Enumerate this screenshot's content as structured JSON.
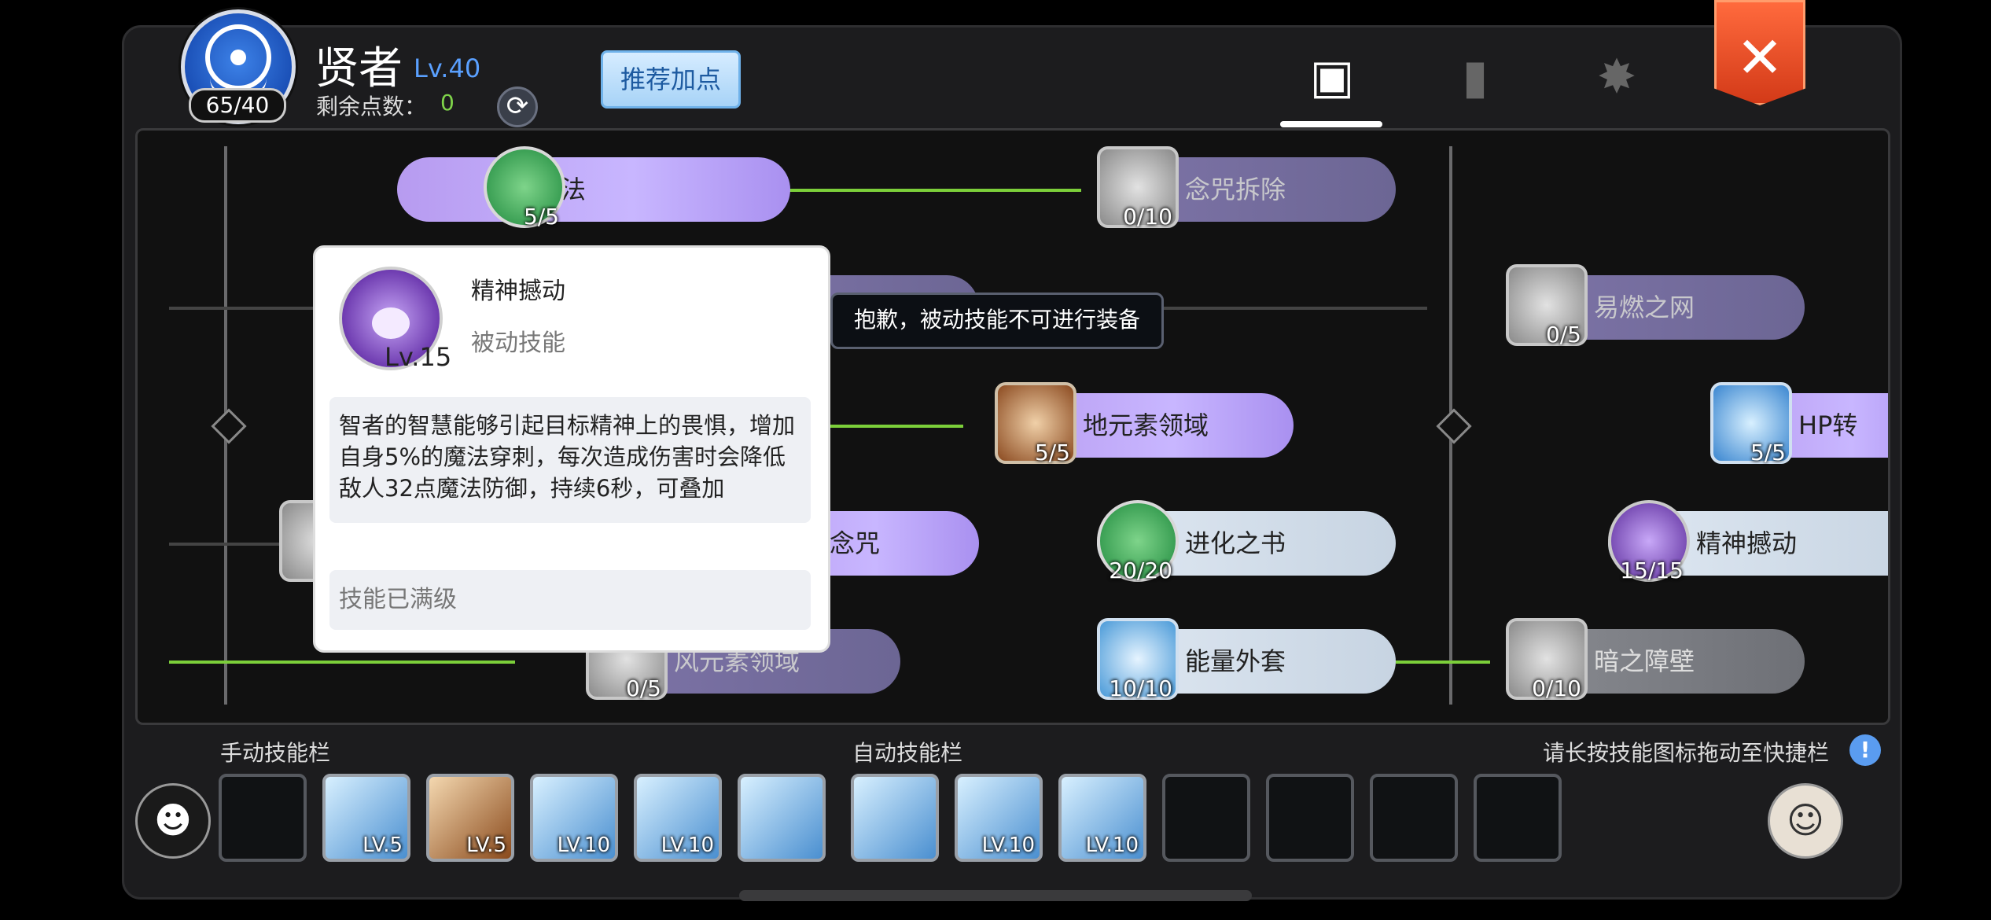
{
  "header": {
    "avatar_count": "65/40",
    "class_name": "贤者",
    "class_level": "Lv.40",
    "points_label": "剩余点数：",
    "points_value": "0",
    "recommend_button": "推荐加点"
  },
  "tabs": [
    {
      "icon": "character-card-icon",
      "active": true
    },
    {
      "icon": "book-icon",
      "active": false
    },
    {
      "icon": "emblem-icon",
      "active": false
    }
  ],
  "skills": [
    {
      "name": "自由施法",
      "level": "5/5"
    },
    {
      "name": "念咒拆除",
      "level": "0/10"
    },
    {
      "name": "易燃之网",
      "level": "0/5"
    },
    {
      "name": "地元素领域",
      "level": "5/5"
    },
    {
      "name": "HP转",
      "level": "5/5"
    },
    {
      "name": "念咒",
      "level": ""
    },
    {
      "name": "进化之书",
      "level": "20/20"
    },
    {
      "name": "精神撼动",
      "level": "15/15"
    },
    {
      "name": "风元素领域",
      "level": "0/5"
    },
    {
      "name": "能量外套",
      "level": "10/10"
    },
    {
      "name": "暗之障壁",
      "level": "0/10"
    }
  ],
  "tooltip": {
    "name": "精神撼动",
    "level": "Lv.15",
    "type": "被动技能",
    "description": "智者的智慧能够引起目标精神上的畏惧，增加自身5%的魔法穿刺，每次造成伤害时会降低敌人32点魔法防御，持续6秒，可叠加",
    "footer": "技能已满级"
  },
  "toast": "抱歉，被动技能不可进行装备",
  "bottom": {
    "manual_label": "手动技能栏",
    "auto_label": "自动技能栏",
    "hint": "请长按技能图标拖动至快捷栏",
    "manual_slots": [
      "",
      "LV.5",
      "LV.5",
      "LV.10",
      "LV.10",
      ""
    ],
    "auto_slots": [
      "",
      "LV.10",
      "LV.10",
      "",
      "",
      "",
      ""
    ]
  },
  "colors": {
    "accent_green": "#7ccf3a",
    "level_blue": "#5aa0ff",
    "close_red": "#d33a18"
  }
}
